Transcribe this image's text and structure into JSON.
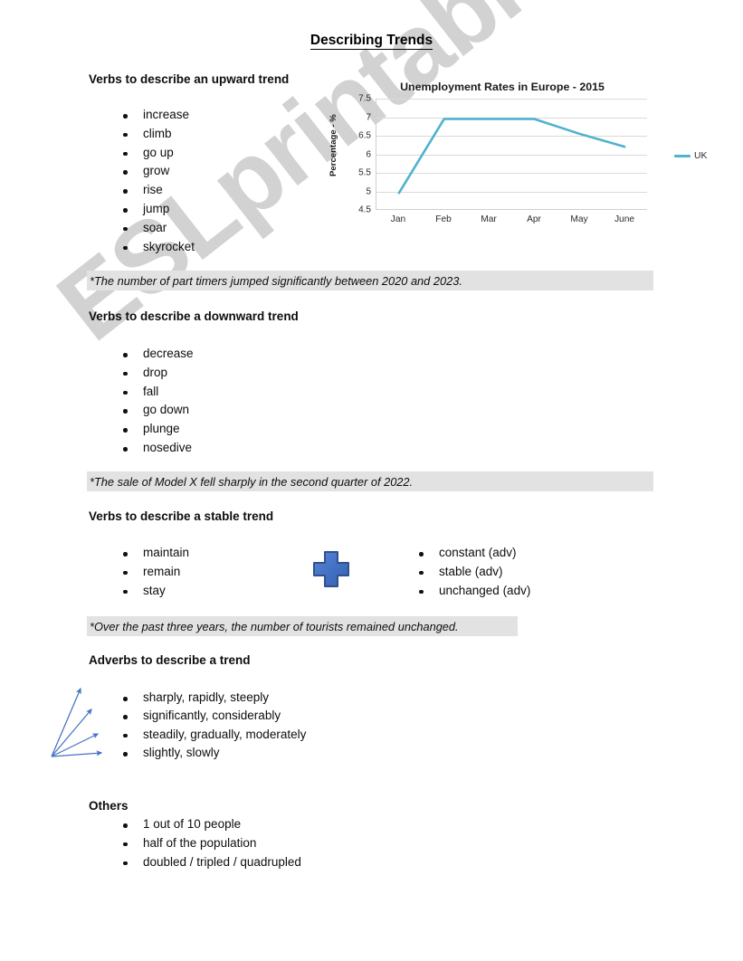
{
  "watermark": {
    "text": "ESLprintables.com"
  },
  "document": {
    "title": "Describing Trends"
  },
  "sections": [
    {
      "heading": "Verbs to describe an upward trend",
      "items": [
        "increase",
        "climb",
        "go up",
        "grow",
        "rise",
        "jump",
        "soar",
        "skyrocket"
      ]
    },
    {
      "heading": "Verbs to describe a downward trend",
      "items": [
        "decrease",
        "drop",
        "fall",
        "go down",
        "plunge",
        "nosedive"
      ]
    },
    {
      "heading": "Verbs to describe a stable trend",
      "items_left": [
        "maintain",
        "remain",
        "stay"
      ],
      "items_right": [
        "constant (adv)",
        "stable (adv)",
        "unchanged (adv)"
      ]
    },
    {
      "heading": "Adverbs to describe a trend",
      "items": [
        "sharply, rapidly, steeply",
        "significantly, considerably",
        "steadily, gradually, moderately",
        "slightly, slowly"
      ]
    },
    {
      "heading": "Others",
      "items": [
        "1 out of 10 people",
        "half of the population",
        "doubled / tripled / quadrupled"
      ]
    }
  ],
  "examples": [
    "*The number of part timers jumped significantly between 2020 and 2023.",
    "*The sale of Model X fell sharply in the second quarter of 2022.",
    "*Over the past three years, the number of tourists remained unchanged."
  ],
  "colors": {
    "line": "#4FB3CC",
    "banner": "#e2e2e2",
    "plus_fill": "#4472C4",
    "plus_stroke": "#2F528F",
    "arrow": "#4472C4",
    "watermark": "#d2d2d2"
  },
  "chart_data": {
    "type": "line",
    "title": "Unemployment Rates in Europe - 2015",
    "xlabel": "",
    "ylabel": "Percentage - %",
    "categories": [
      "Jan",
      "Feb",
      "Mar",
      "Apr",
      "May",
      "June"
    ],
    "series": [
      {
        "name": "UK",
        "values": [
          4.95,
          6.95,
          6.95,
          6.95,
          6.55,
          6.2
        ],
        "color": "#4FB3CC"
      }
    ],
    "ylim": [
      4.5,
      7.5
    ],
    "yticks": [
      4.5,
      5,
      5.5,
      6,
      6.5,
      7,
      7.5
    ],
    "ytick_labels": [
      "4.5",
      "5",
      "5.5",
      "6",
      "6.5",
      "7",
      "7.5"
    ],
    "grid": true,
    "legend": "right",
    "legend_entries": [
      "UK"
    ]
  }
}
